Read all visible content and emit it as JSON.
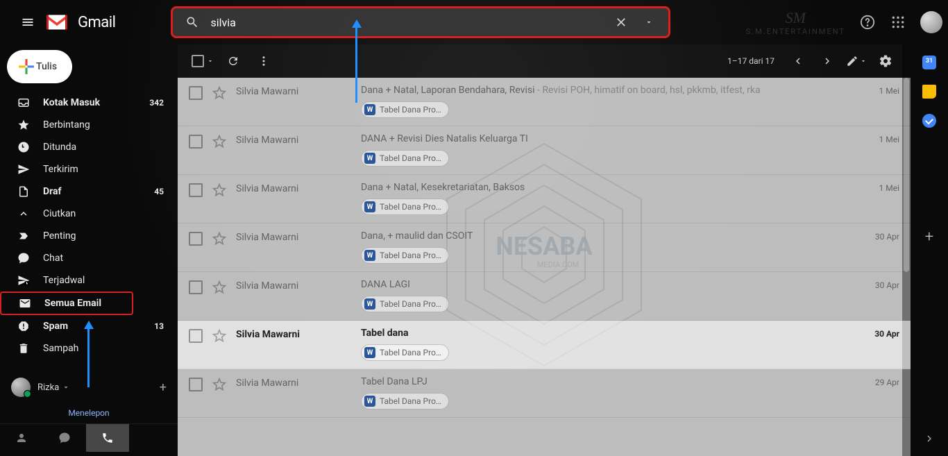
{
  "header": {
    "app_name": "Gmail",
    "search_value": "silvia",
    "watermark_top": "S.M.ENTERTAINMENT"
  },
  "compose_label": "Tulis",
  "sidebar": {
    "items": [
      {
        "icon": "inbox",
        "label": "Kotak Masuk",
        "count": "342",
        "bold": true
      },
      {
        "icon": "star",
        "label": "Berbintang",
        "count": ""
      },
      {
        "icon": "clock",
        "label": "Ditunda",
        "count": ""
      },
      {
        "icon": "send",
        "label": "Terkirim",
        "count": ""
      },
      {
        "icon": "draft",
        "label": "Draf",
        "count": "45",
        "bold": true
      },
      {
        "icon": "collapse",
        "label": "Ciutkan",
        "count": ""
      },
      {
        "icon": "important",
        "label": "Penting",
        "count": ""
      },
      {
        "icon": "chat",
        "label": "Chat",
        "count": ""
      },
      {
        "icon": "schedule",
        "label": "Terjadwal",
        "count": ""
      },
      {
        "icon": "allmail",
        "label": "Semua Email",
        "count": "",
        "bold": true,
        "highlight": true
      },
      {
        "icon": "spam",
        "label": "Spam",
        "count": "13",
        "bold": true
      },
      {
        "icon": "trash",
        "label": "Sampah",
        "count": ""
      }
    ],
    "hangouts_user": "Rizka",
    "menelepon": "Menelepon"
  },
  "toolbar": {
    "pagination": "1–17 dari 17"
  },
  "attachment_chip_label": "Tabel Dana Pro…",
  "emails": [
    {
      "sender": "Silvia Mawarni",
      "subject": "Dana + Natal, Laporan Bendahara, Revisi",
      "preview": " - Revisi POH, himatif on board, hsl, pkkmb, itfest, rka",
      "date": "1 Mei",
      "unread": false
    },
    {
      "sender": "Silvia Mawarni",
      "subject": "DANA + Revisi Dies Natalis Keluarga TI",
      "preview": "",
      "date": "1 Mei",
      "unread": false
    },
    {
      "sender": "Silvia Mawarni",
      "subject": "Dana + Natal, Kesekretariatan, Baksos",
      "preview": "",
      "date": "1 Mei",
      "unread": false
    },
    {
      "sender": "Silvia Mawarni",
      "subject": "Dana, + maulid dan CSOIT",
      "preview": "",
      "date": "30 Apr",
      "unread": false
    },
    {
      "sender": "Silvia Mawarni",
      "subject": "DANA LAGI",
      "preview": "",
      "date": "30 Apr",
      "unread": false
    },
    {
      "sender": "Silvia Mawarni",
      "subject": "Tabel dana",
      "preview": "",
      "date": "30 Apr",
      "unread": true
    },
    {
      "sender": "Silvia Mawarni",
      "subject": "Tabel Dana LPJ",
      "preview": "",
      "date": "29 Apr",
      "unread": false
    }
  ],
  "watermark_main": "NESABA",
  "watermark_sub": "MEDIA.COM"
}
